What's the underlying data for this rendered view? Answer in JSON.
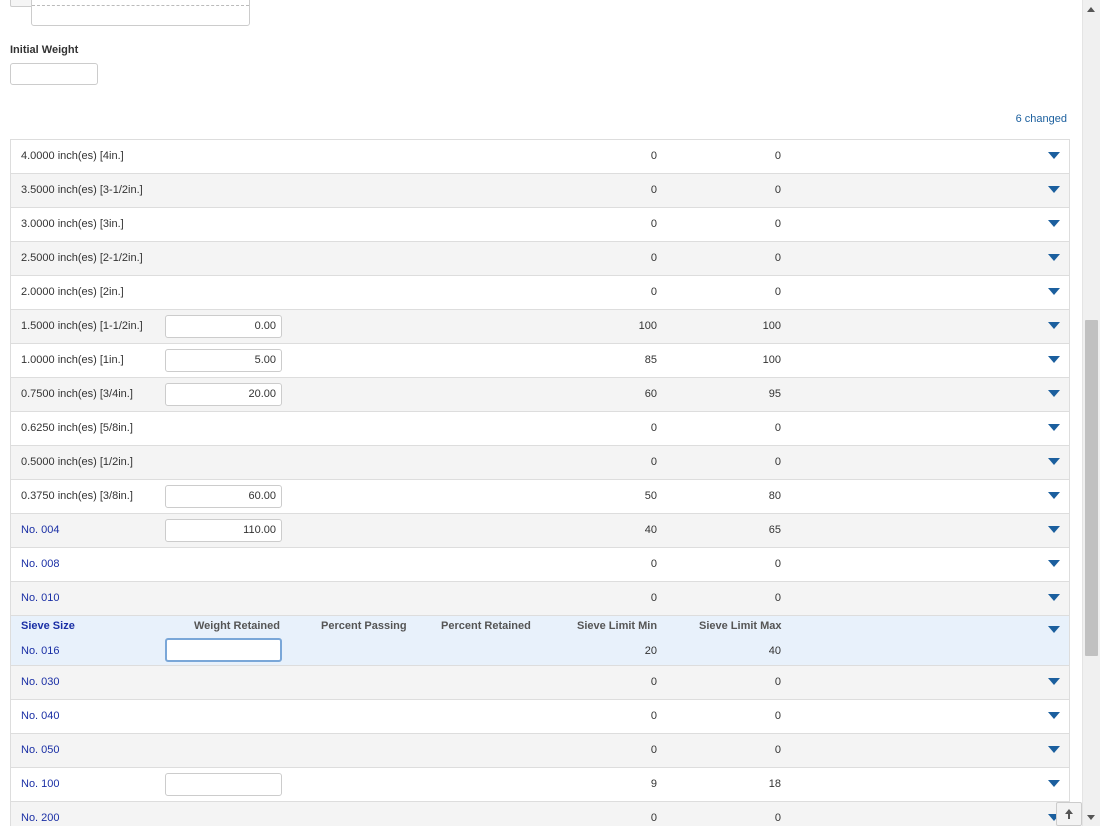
{
  "form": {
    "initial_weight_label": "Initial Weight",
    "initial_weight_value": "",
    "changed_text": "6 changed"
  },
  "table": {
    "headers": {
      "sieve_size": "Sieve Size",
      "weight_retained": "Weight Retained",
      "percent_passing": "Percent Passing",
      "percent_retained": "Percent Retained",
      "sieve_limit_min": "Sieve Limit Min",
      "sieve_limit_max": "Sieve Limit Max"
    },
    "rows": [
      {
        "sieve": "4.0000 inch(es) [4in.]",
        "weight": null,
        "min": "0",
        "max": "0",
        "link": false
      },
      {
        "sieve": "3.5000 inch(es) [3-1/2in.]",
        "weight": null,
        "min": "0",
        "max": "0",
        "link": false
      },
      {
        "sieve": "3.0000 inch(es) [3in.]",
        "weight": null,
        "min": "0",
        "max": "0",
        "link": false
      },
      {
        "sieve": "2.5000 inch(es) [2-1/2in.]",
        "weight": null,
        "min": "0",
        "max": "0",
        "link": false
      },
      {
        "sieve": "2.0000 inch(es) [2in.]",
        "weight": null,
        "min": "0",
        "max": "0",
        "link": false
      },
      {
        "sieve": "1.5000 inch(es) [1-1/2in.]",
        "weight": "0.00",
        "min": "100",
        "max": "100",
        "link": false
      },
      {
        "sieve": "1.0000 inch(es) [1in.]",
        "weight": "5.00",
        "min": "85",
        "max": "100",
        "link": false
      },
      {
        "sieve": "0.7500 inch(es) [3/4in.]",
        "weight": "20.00",
        "min": "60",
        "max": "95",
        "link": false
      },
      {
        "sieve": "0.6250 inch(es) [5/8in.]",
        "weight": null,
        "min": "0",
        "max": "0",
        "link": false
      },
      {
        "sieve": "0.5000 inch(es) [1/2in.]",
        "weight": null,
        "min": "0",
        "max": "0",
        "link": false
      },
      {
        "sieve": "0.3750 inch(es) [3/8in.]",
        "weight": "60.00",
        "min": "50",
        "max": "80",
        "link": false
      },
      {
        "sieve": "No. 004",
        "weight": "110.00",
        "min": "40",
        "max": "65",
        "link": true
      },
      {
        "sieve": "No. 008",
        "weight": null,
        "min": "0",
        "max": "0",
        "link": true
      },
      {
        "sieve": "No. 010",
        "weight": null,
        "min": "0",
        "max": "0",
        "link": true
      }
    ],
    "expanded_row": {
      "sieve": "No. 016",
      "weight": "",
      "min": "20",
      "max": "40"
    },
    "rows_after": [
      {
        "sieve": "No. 030",
        "weight": null,
        "min": "0",
        "max": "0",
        "link": true
      },
      {
        "sieve": "No. 040",
        "weight": null,
        "min": "0",
        "max": "0",
        "link": true
      },
      {
        "sieve": "No. 050",
        "weight": null,
        "min": "0",
        "max": "0",
        "link": true
      },
      {
        "sieve": "No. 100",
        "weight": "",
        "min": "9",
        "max": "18",
        "link": true
      },
      {
        "sieve": "No. 200",
        "weight": null,
        "min": "0",
        "max": "0",
        "link": true
      }
    ]
  },
  "icons": {
    "row_toggle": "caret-down-icon",
    "scroll_to_top": "arrow-up-icon"
  },
  "colors": {
    "accent": "#1b5f9e",
    "link": "#1a2fa5",
    "expanded_row_bg": "#e8f1fb",
    "alt_row_bg": "#f4f4f4"
  }
}
